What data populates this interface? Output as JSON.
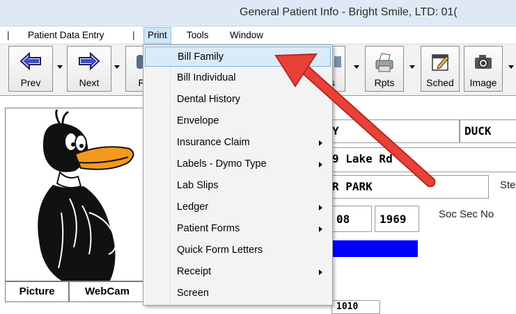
{
  "window": {
    "title": "General Patient Info - Bright Smile, LTD: 01("
  },
  "menubar": {
    "separator": "|",
    "items": [
      {
        "label": "Patient Data Entry"
      },
      {
        "label": "Print"
      },
      {
        "label": "Tools"
      },
      {
        "label": "Window"
      }
    ]
  },
  "toolbar": {
    "buttons": [
      {
        "label": "Prev",
        "icon": "left-arrow-icon"
      },
      {
        "label": "Next",
        "icon": "right-arrow-icon"
      },
      {
        "label": "F",
        "icon": "family-icon"
      },
      {
        "label": "s",
        "icon": "list-icon"
      },
      {
        "label": "Rpts",
        "icon": "printer-icon"
      },
      {
        "label": "Sched",
        "icon": "calendar-icon"
      },
      {
        "label": "Image",
        "icon": "camera-icon"
      }
    ]
  },
  "print_menu": {
    "items": [
      {
        "label": "Bill Family",
        "submenu": false,
        "highlighted": true
      },
      {
        "label": "Bill Individual",
        "submenu": false
      },
      {
        "label": "Dental History",
        "submenu": false
      },
      {
        "label": "Envelope",
        "submenu": false
      },
      {
        "label": "Insurance Claim",
        "submenu": true
      },
      {
        "label": "Labels - Dymo Type",
        "submenu": true
      },
      {
        "label": "Lab Slips",
        "submenu": false
      },
      {
        "label": "Ledger",
        "submenu": true
      },
      {
        "label": "Patient Forms",
        "submenu": true
      },
      {
        "label": "Quick Form Letters",
        "submenu": false
      },
      {
        "label": "Receipt",
        "submenu": true
      },
      {
        "label": "Screen",
        "submenu": false
      }
    ]
  },
  "patient": {
    "first_name_partial": "Y",
    "last_name": "DUCK",
    "address_partial": "9 Lake Rd",
    "city_partial": "R PARK",
    "state_label_partial": "Ste",
    "dob_day": "08",
    "dob_year": "1969",
    "ssn_label": "Soc Sec No",
    "bottom_partial": "1010"
  },
  "picture_tabs": [
    {
      "label": "Picture"
    },
    {
      "label": "WebCam"
    }
  ],
  "colors": {
    "annotation_arrow": "#e8413a",
    "highlight": "#d9ebf9",
    "blue_bar": "#0000ff"
  }
}
